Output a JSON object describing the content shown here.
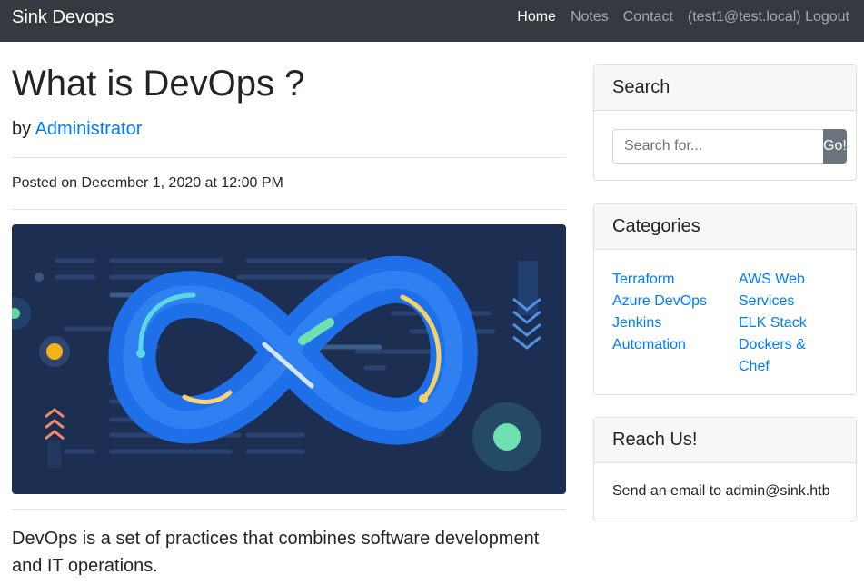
{
  "nav": {
    "brand": "Sink Devops",
    "links": [
      "Home",
      "Notes",
      "Contact",
      "(test1@test.local) Logout"
    ]
  },
  "post": {
    "title": "What is DevOps ?",
    "by_prefix": "by",
    "author": "Administrator",
    "posted": "Posted on December 1, 2020 at 12:00 PM",
    "lead": "DevOps is a set of practices that combines software development and IT operations."
  },
  "sidebar": {
    "search": {
      "title": "Search",
      "placeholder": "Search for...",
      "button": "Go!"
    },
    "categories": {
      "title": "Categories",
      "left": [
        "Terraform",
        "Azure DevOps",
        "Jenkins",
        "Automation"
      ],
      "right": [
        "AWS Web Services",
        "ELK Stack",
        "Dockers & Chef"
      ]
    },
    "reach": {
      "title": "Reach Us!",
      "text": "Send an email to admin@sink.htb"
    }
  },
  "colors": {
    "navbar": "#343a40",
    "link": "#007bff",
    "hero_bg": "#1c2e52",
    "infinity": "#1f6fe8"
  }
}
